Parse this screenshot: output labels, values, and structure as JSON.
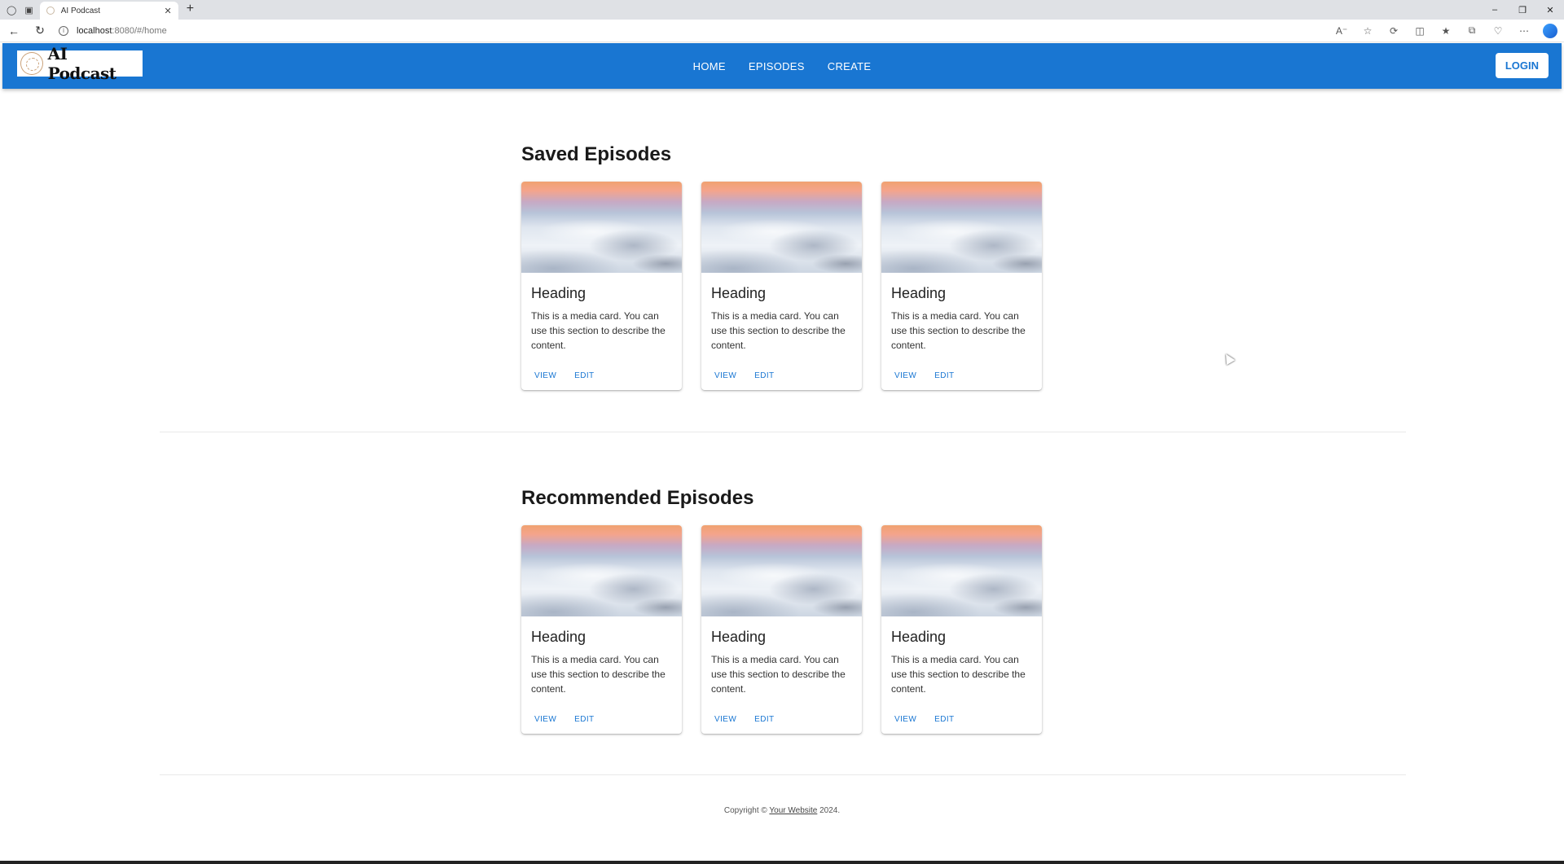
{
  "browser": {
    "tab_title": "AI Podcast",
    "url_host": "localhost",
    "url_rest": ":8080/#/home"
  },
  "appbar": {
    "logo_text": "AI Podcast",
    "nav": [
      "HOME",
      "EPISODES",
      "CREATE"
    ],
    "login_label": "LOGIN",
    "color": "#1976d2"
  },
  "saved": {
    "title": "Saved Episodes",
    "cards": [
      {
        "heading": "Heading",
        "body": "This is a media card. You can use this section to describe the content.",
        "view": "VIEW",
        "edit": "EDIT"
      },
      {
        "heading": "Heading",
        "body": "This is a media card. You can use this section to describe the content.",
        "view": "VIEW",
        "edit": "EDIT"
      },
      {
        "heading": "Heading",
        "body": "This is a media card. You can use this section to describe the content.",
        "view": "VIEW",
        "edit": "EDIT"
      }
    ]
  },
  "recommended": {
    "title": "Recommended Episodes",
    "cards": [
      {
        "heading": "Heading",
        "body": "This is a media card. You can use this section to describe the content.",
        "view": "VIEW",
        "edit": "EDIT"
      },
      {
        "heading": "Heading",
        "body": "This is a media card. You can use this section to describe the content.",
        "view": "VIEW",
        "edit": "EDIT"
      },
      {
        "heading": "Heading",
        "body": "This is a media card. You can use this section to describe the content.",
        "view": "VIEW",
        "edit": "EDIT"
      }
    ]
  },
  "footer": {
    "prefix": "Copyright © ",
    "link": "Your Website",
    "suffix": " 2024."
  }
}
